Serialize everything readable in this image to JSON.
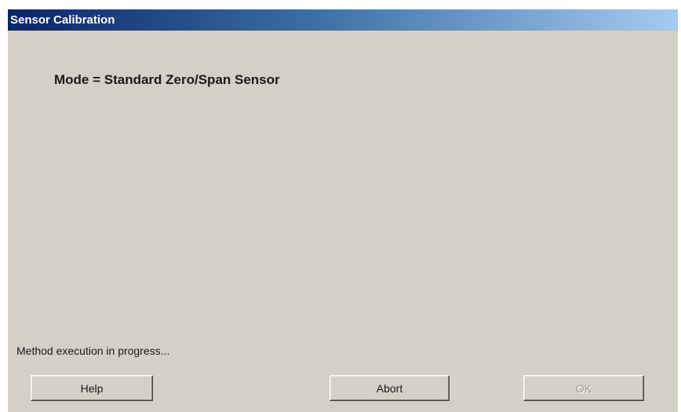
{
  "window": {
    "title": "Sensor Calibration"
  },
  "content": {
    "mode_label": "Mode = Standard Zero/Span Sensor",
    "status": "Method execution in progress..."
  },
  "buttons": {
    "help_label": "Help",
    "abort_label": "Abort",
    "ok_label": "OK",
    "ok_enabled": false
  },
  "colors": {
    "title_gradient_start": "#0a246a",
    "title_gradient_end": "#a6caf0",
    "dialog_background": "#d4d0c8"
  }
}
